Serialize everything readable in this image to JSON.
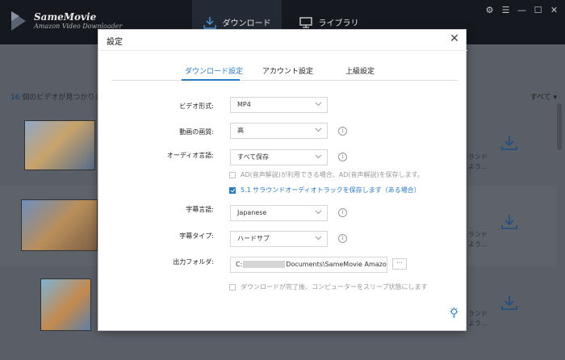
{
  "app": {
    "name": "SameMovie",
    "subtitle": "Amazon Video Downloader",
    "tab_download": "ダウンロード",
    "tab_library": "ライブラリ"
  },
  "main": {
    "count_num": "16",
    "count_text": " 個のビデオが見つかりま",
    "filter": "すべて ▾",
    "rows": [
      {
        "note_line1": "ランド",
        "note_line2": "よう..."
      },
      {
        "note_line1": "ランド",
        "note_line2": "よう..."
      },
      {
        "note_line1": "ランド",
        "note_line2": "よう..."
      }
    ]
  },
  "dialog": {
    "title": "設定",
    "tabs": [
      "ダウンロード設定",
      "アカウント設定",
      "上級設定"
    ],
    "labels": {
      "video_format": "ビデオ形式:",
      "video_quality": "動画の画質:",
      "audio_language": "オーディオ言語:",
      "subtitle_language": "字幕言語:",
      "subtitle_type": "字幕タイプ:",
      "output_folder": "出力フォルダ:"
    },
    "values": {
      "video_format": "MP4",
      "video_quality": "高",
      "audio_language": "すべて保存",
      "subtitle_language": "Japanese",
      "subtitle_type": "ハードサブ",
      "output_prefix": "C:",
      "output_suffix": "Documents\\SameMovie Amazo",
      "browse": "···"
    },
    "checkboxes": {
      "ad_audio": "AD(音声解説)が利用できる場合、AD(音声解説)を保存します。",
      "surround": "5.1 サラウンドオーディオトラックを保存します（ある場合）",
      "sleep": "ダウンロードが完了後、コンピューターをスリープ状態にします"
    },
    "checkbox_state": {
      "ad_audio": false,
      "surround": true,
      "sleep": false
    }
  },
  "colors": {
    "accent": "#2a7ac2",
    "header_bg": "#15191f"
  }
}
